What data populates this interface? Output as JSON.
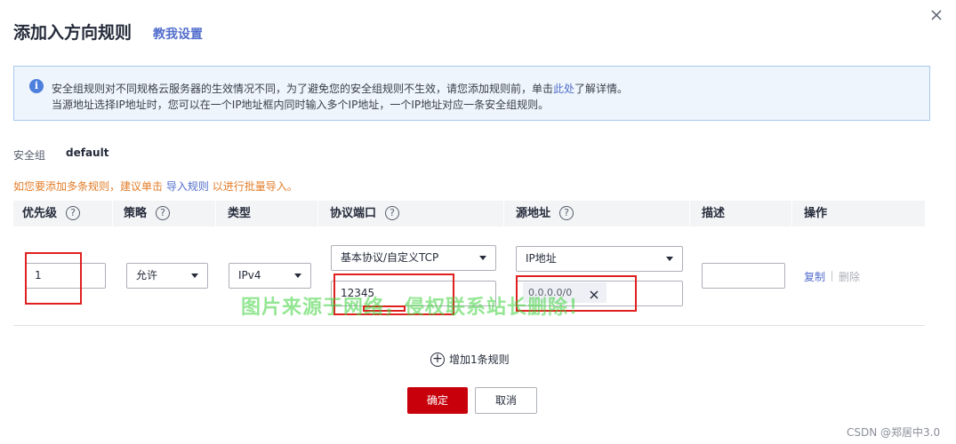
{
  "dialog": {
    "title": "添加入方向规则",
    "help_link": "教我设置"
  },
  "notice": {
    "line1_before": "安全组规则对不同规格云服务器的生效情况不同，为了避免您的安全组规则不生效，请您添加规则前，单击",
    "line1_link": "此处",
    "line1_after": "了解详情。",
    "line2": "当源地址选择IP地址时，您可以在一个IP地址框内同时输入多个IP地址，一个IP地址对应一条安全组规则。"
  },
  "security_group": {
    "label": "安全组",
    "value": "default"
  },
  "hint": {
    "before": "如您要添加多条规则，建议单击",
    "link": "导入规则",
    "after": "以进行批量导入。"
  },
  "table": {
    "headers": {
      "priority": "优先级",
      "policy": "策略",
      "type": "类型",
      "protocol_port": "协议端口",
      "source": "源地址",
      "description": "描述",
      "action": "操作"
    },
    "help_glyph": "?",
    "row": {
      "priority": "1",
      "policy": "允许",
      "type": "IPv4",
      "protocol": "基本协议/自定义TCP",
      "port": "12345",
      "source_type": "IP地址",
      "source_ip": "0.0.0.0/0",
      "description": "",
      "copy": "复制",
      "delete": "删除"
    }
  },
  "watermark": "图片来源于网络，侵权联系站长删除！",
  "add_rule": {
    "glyph": "+",
    "label": "增加1条规则"
  },
  "buttons": {
    "ok": "确定",
    "cancel": "取消"
  },
  "credit": "CSDN @郑居中3.0",
  "colors": {
    "primary": "#c7000b",
    "link": "#526ecc",
    "hint": "#e37d29",
    "notice_bg": "#eef5fc",
    "annotation": "#e02020"
  }
}
